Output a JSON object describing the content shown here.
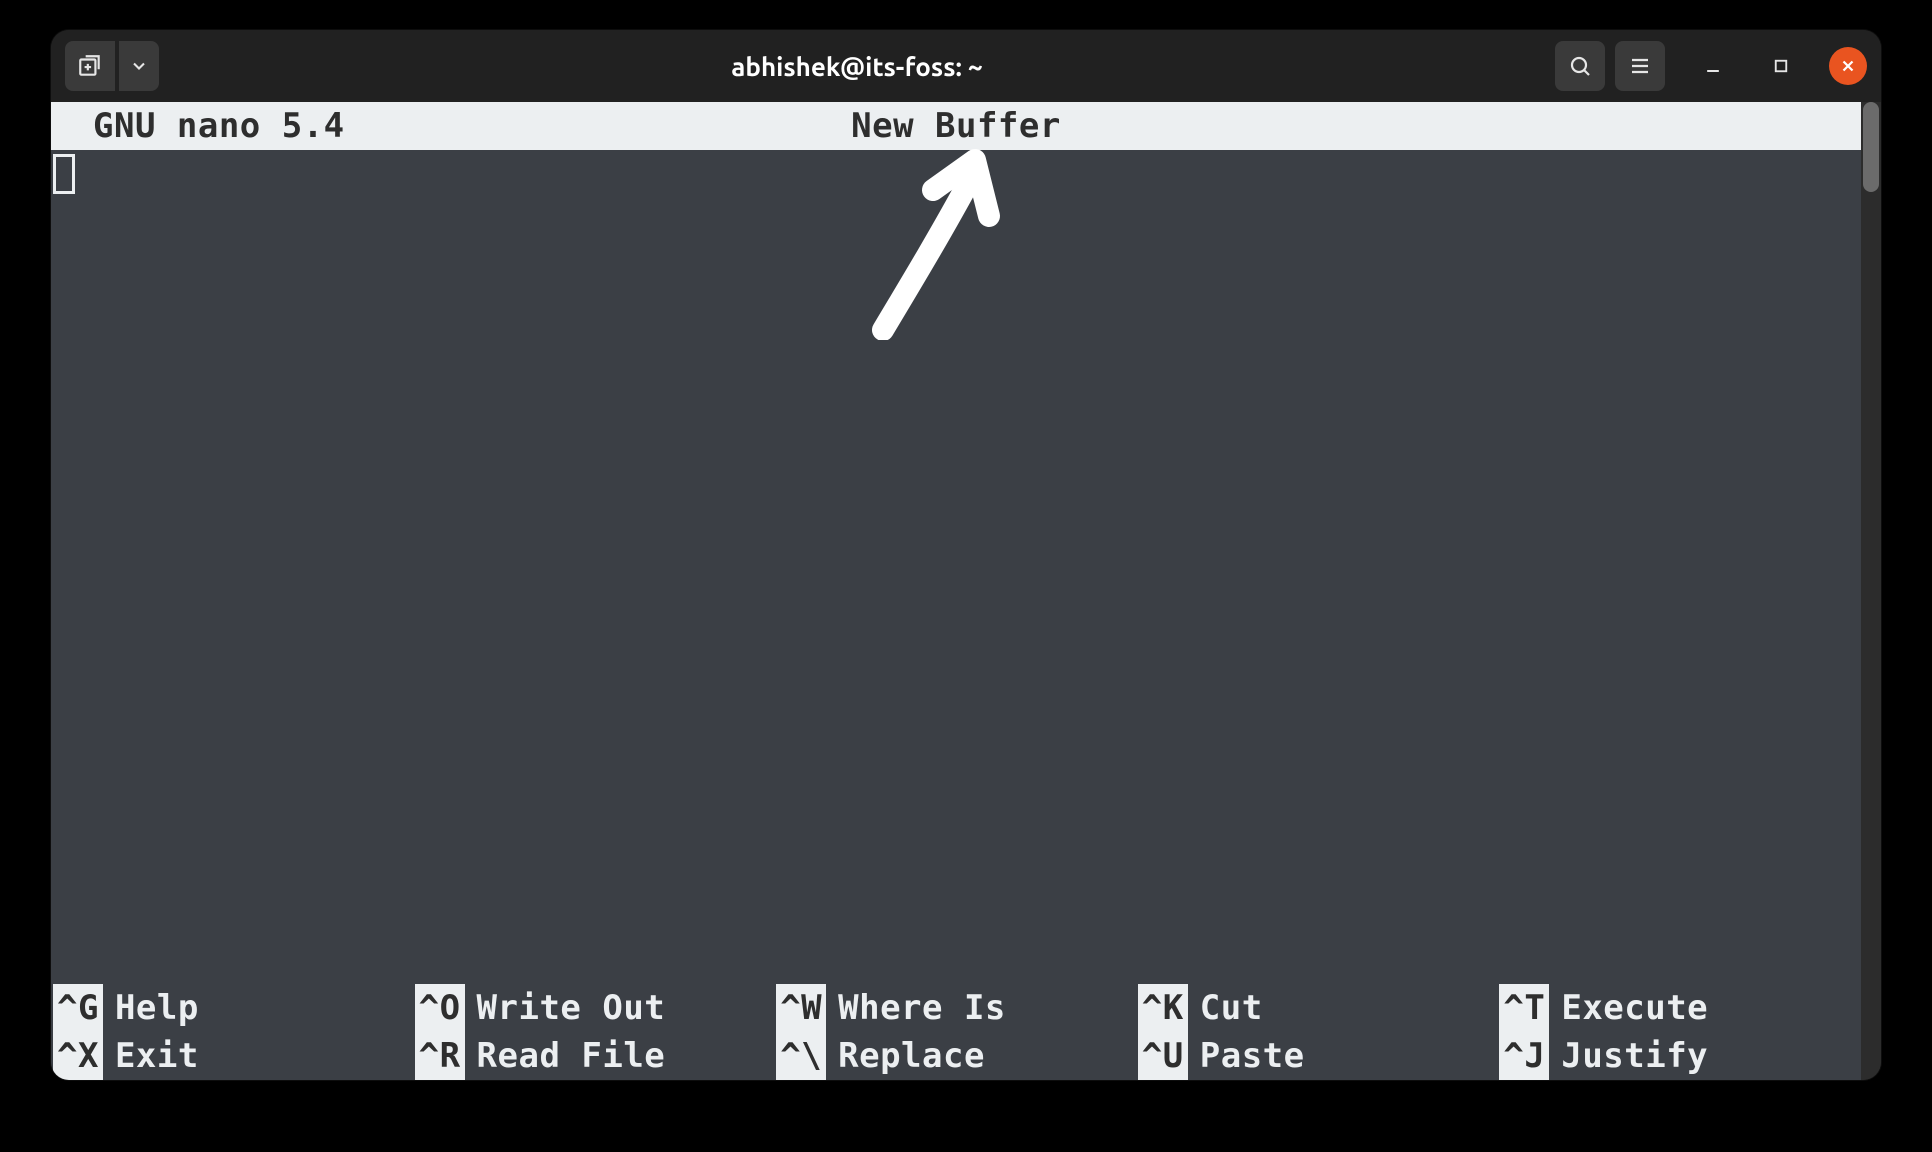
{
  "titlebar": {
    "title": "abhishek@its-foss: ~"
  },
  "nano": {
    "version_label": "GNU nano 5.4",
    "buffer_label": "New Buffer"
  },
  "shortcuts": {
    "row1": [
      {
        "key": "^G",
        "label": "Help"
      },
      {
        "key": "^O",
        "label": "Write Out"
      },
      {
        "key": "^W",
        "label": "Where Is"
      },
      {
        "key": "^K",
        "label": "Cut"
      },
      {
        "key": "^T",
        "label": "Execute"
      }
    ],
    "row2": [
      {
        "key": "^X",
        "label": "Exit"
      },
      {
        "key": "^R",
        "label": "Read File"
      },
      {
        "key": "^\\",
        "label": "Replace"
      },
      {
        "key": "^U",
        "label": "Paste"
      },
      {
        "key": "^J",
        "label": "Justify"
      }
    ]
  }
}
